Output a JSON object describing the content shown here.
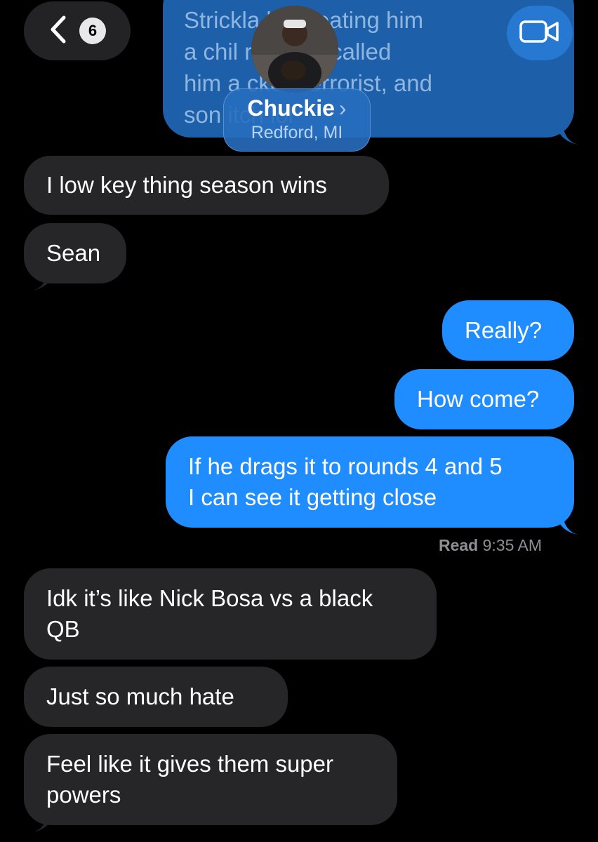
{
  "header": {
    "back_count": "6",
    "contact_name": "Chuckie",
    "contact_chevron": "›",
    "contact_location": "Redford, MI",
    "back_icon": "chevron-left-icon",
    "video_icon": "video-camera-icon"
  },
  "top_message_partial": "Strickla        lad beating him\na chil          rickland called\nhim a            cker, terrorist, and\nson                   itch lol",
  "messages": [
    {
      "side": "in",
      "text": "I low key thing season wins"
    },
    {
      "side": "in",
      "text": "Sean"
    },
    {
      "side": "out",
      "text": "Really?"
    },
    {
      "side": "out",
      "text": "How come?"
    },
    {
      "side": "out",
      "text": "If he drags it to rounds 4 and 5\nI can see it getting close"
    },
    {
      "side": "in",
      "text": "Idk it’s like Nick Bosa vs a black\nQB"
    },
    {
      "side": "in",
      "text": "Just so much hate"
    },
    {
      "side": "in",
      "text": "Feel like it gives them super\npowers"
    }
  ],
  "read_receipt": {
    "label": "Read",
    "time": "9:35 AM"
  },
  "colors": {
    "background": "#000000",
    "incoming_bubble": "#262628",
    "outgoing_bubble": "#1f8cff",
    "timestamp": "#8e8e93"
  }
}
